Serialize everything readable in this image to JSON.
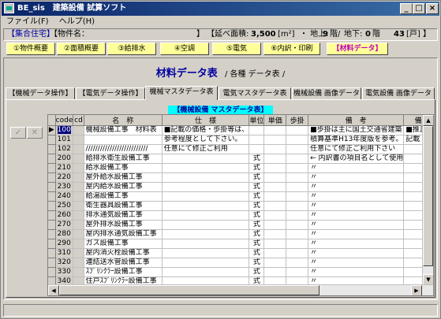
{
  "window": {
    "title": "BE_sis　建築設備 試算ソフト"
  },
  "menu": [
    "ファイル(F)",
    "ヘルプ(H)"
  ],
  "info": {
    "tag": "【集合住宅】",
    "property_label": "【物件名：",
    "close_bracket": "】",
    "area_label": "【延べ面積:",
    "area_value": "3,500",
    "area_unit": "[m²]",
    "floors_above_label": "・ 地上:",
    "floors_above": "9",
    "floors_above_unit": "階/",
    "floors_below_label": "地下:",
    "floors_below": "0",
    "floors_below_unit": "階",
    "units_value": "43",
    "units_unit": "[戸] 】"
  },
  "nav_buttons": [
    "①物件概要",
    "②面積概要",
    "③給排水",
    "④空調",
    "⑤電気",
    "⑥内訳・印刷",
    "【材料データ】"
  ],
  "heading": {
    "title": "材料データ表",
    "subtitle": "/ 各種 データ表 /"
  },
  "tabs": [
    "【機械データ操作】",
    "【電気データ操作】",
    "機械マスタデータ表",
    "電気マスタデータ表",
    "機械設備 画像データ",
    "電気設備 画像データ"
  ],
  "grid_title": "【機械設備 マスタデータ表】",
  "nav_icons": {
    "check": "✓",
    "cancel": "✕"
  },
  "grid": {
    "columns": [
      "code",
      "cd",
      "名　称",
      "仕　様",
      "単位",
      "単価",
      "歩掛",
      "備　考",
      "備"
    ],
    "rows": [
      {
        "code": "100",
        "cd": "",
        "name": "機械設備工事　材料表",
        "spec": "■記載の価格・歩掛等は、",
        "unit": "",
        "price": "",
        "rate": "",
        "note": "■歩掛は主に国土交通省建築",
        "extra": "■推測"
      },
      {
        "code": "101",
        "cd": "",
        "name": "",
        "spec": "参考程度として下さい。",
        "unit": "",
        "price": "",
        "rate": "",
        "note": "積算基準H13年度版を参考。",
        "extra": "記載"
      },
      {
        "code": "102",
        "cd": "",
        "name": "//////////////////////////",
        "spec": "任意にて修正ご利用",
        "unit": "",
        "price": "",
        "rate": "",
        "note": "任意にて修正ご利用下さい",
        "extra": ""
      },
      {
        "code": "200",
        "cd": "",
        "name": "給排水衛生設備工事",
        "spec": "",
        "unit": "式",
        "price": "",
        "rate": "",
        "note": "← 内訳書の項目名として使用",
        "extra": ""
      },
      {
        "code": "210",
        "cd": "",
        "name": "給水設備工事",
        "spec": "",
        "unit": "式",
        "price": "",
        "rate": "",
        "note": "〃",
        "extra": ""
      },
      {
        "code": "220",
        "cd": "",
        "name": "屋外給水設備工事",
        "spec": "",
        "unit": "式",
        "price": "",
        "rate": "",
        "note": "〃",
        "extra": ""
      },
      {
        "code": "230",
        "cd": "",
        "name": "屋内給水設備工事",
        "spec": "",
        "unit": "式",
        "price": "",
        "rate": "",
        "note": "〃",
        "extra": ""
      },
      {
        "code": "240",
        "cd": "",
        "name": "給湯設備工事",
        "spec": "",
        "unit": "式",
        "price": "",
        "rate": "",
        "note": "〃",
        "extra": ""
      },
      {
        "code": "250",
        "cd": "",
        "name": "衛生器具設備工事",
        "spec": "",
        "unit": "式",
        "price": "",
        "rate": "",
        "note": "〃",
        "extra": ""
      },
      {
        "code": "260",
        "cd": "",
        "name": "排水通気設備工事",
        "spec": "",
        "unit": "式",
        "price": "",
        "rate": "",
        "note": "〃",
        "extra": ""
      },
      {
        "code": "270",
        "cd": "",
        "name": "屋外排水設備工事",
        "spec": "",
        "unit": "式",
        "price": "",
        "rate": "",
        "note": "〃",
        "extra": ""
      },
      {
        "code": "280",
        "cd": "",
        "name": "屋内排水通気設備工事",
        "spec": "",
        "unit": "式",
        "price": "",
        "rate": "",
        "note": "〃",
        "extra": ""
      },
      {
        "code": "290",
        "cd": "",
        "name": "ガス設備工事",
        "spec": "",
        "unit": "式",
        "price": "",
        "rate": "",
        "note": "〃",
        "extra": ""
      },
      {
        "code": "310",
        "cd": "",
        "name": "屋内消火栓設備工事",
        "spec": "",
        "unit": "式",
        "price": "",
        "rate": "",
        "note": "〃",
        "extra": ""
      },
      {
        "code": "320",
        "cd": "",
        "name": "連結送水管設備工事",
        "spec": "",
        "unit": "式",
        "price": "",
        "rate": "",
        "note": "〃",
        "extra": ""
      },
      {
        "code": "330",
        "cd": "",
        "name": "ｽﾌﾟﾘﾝｸﾗｰ設備工事",
        "spec": "",
        "unit": "式",
        "price": "",
        "rate": "",
        "note": "〃",
        "extra": ""
      },
      {
        "code": "340",
        "cd": "",
        "name": "住戸ｽﾌﾟﾘﾝｸﾗｰ設備工事",
        "spec": "",
        "unit": "式",
        "price": "",
        "rate": "",
        "note": "〃",
        "extra": ""
      }
    ]
  }
}
